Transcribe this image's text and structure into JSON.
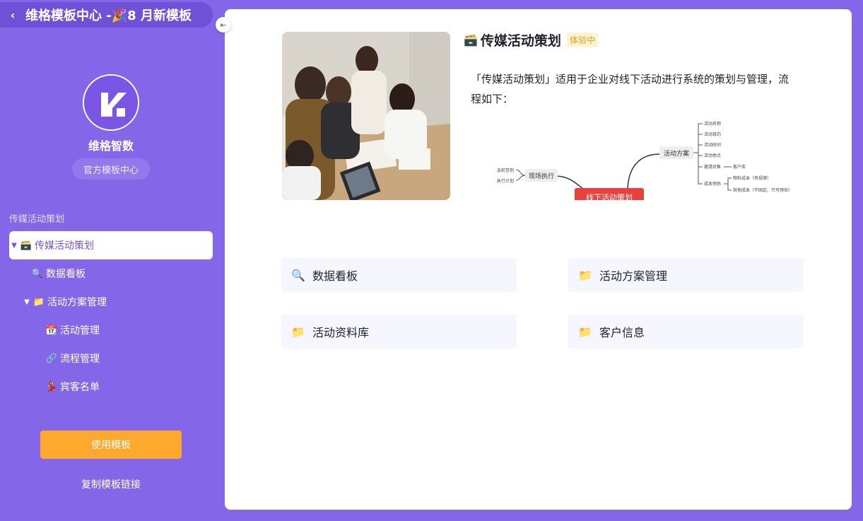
{
  "header": {
    "back_icon": "‹",
    "title": "维格模板中心 -🎉8 月新模板"
  },
  "sidebar": {
    "collapse_icon": "⇤",
    "brand_name": "维格智数",
    "brand_badge": "官方模板中心",
    "section_label": "传媒活动策划",
    "tree": [
      {
        "label": "传媒活动策划",
        "emoji": "🗃️",
        "caret": "▼",
        "active": true
      },
      {
        "label": "数据看板",
        "emoji": "🔍",
        "caret": ""
      },
      {
        "label": "活动方案管理",
        "emoji": "📁",
        "caret": "▼"
      },
      {
        "label": "活动管理",
        "emoji": "📆",
        "caret": ""
      },
      {
        "label": "流程管理",
        "emoji": "🔗",
        "caret": ""
      },
      {
        "label": "宾客名单",
        "emoji": "💃",
        "caret": ""
      }
    ],
    "use_button": "使用模板",
    "copy_link": "复制模板链接"
  },
  "template": {
    "emoji": "🗃️",
    "title": "传媒活动策划",
    "badge": "体验中",
    "description": "「传媒活动策划」适用于企业对线下活动进行系统的策划与管理，流程如下："
  },
  "mindmap": {
    "center": "线下活动策划",
    "left_node": "现场执行",
    "left_children": [
      "会前签到",
      "执行计划"
    ],
    "right_node": "活动方案",
    "right_children": [
      "活动名称",
      "活动目的",
      "活动时间",
      "活动地点",
      "邀请对象",
      "成本预估"
    ],
    "invite_child": "客户库",
    "cost_children": [
      "物料成本（有规律）",
      "其他成本（不固定、只可预估）"
    ]
  },
  "cards": [
    {
      "emoji": "🔍",
      "label": "数据看板"
    },
    {
      "emoji": "📁",
      "label": "活动方案管理"
    },
    {
      "emoji": "📁",
      "label": "活动资料库"
    },
    {
      "emoji": "📁",
      "label": "客户信息"
    }
  ],
  "colors": {
    "sidebar_bg": "#8466e8",
    "accent": "#7552e6",
    "use_button": "#ffa82e",
    "badge_bg": "#fff3d6",
    "badge_text": "#e0a21a",
    "card_bg": "#f5f6ff"
  }
}
